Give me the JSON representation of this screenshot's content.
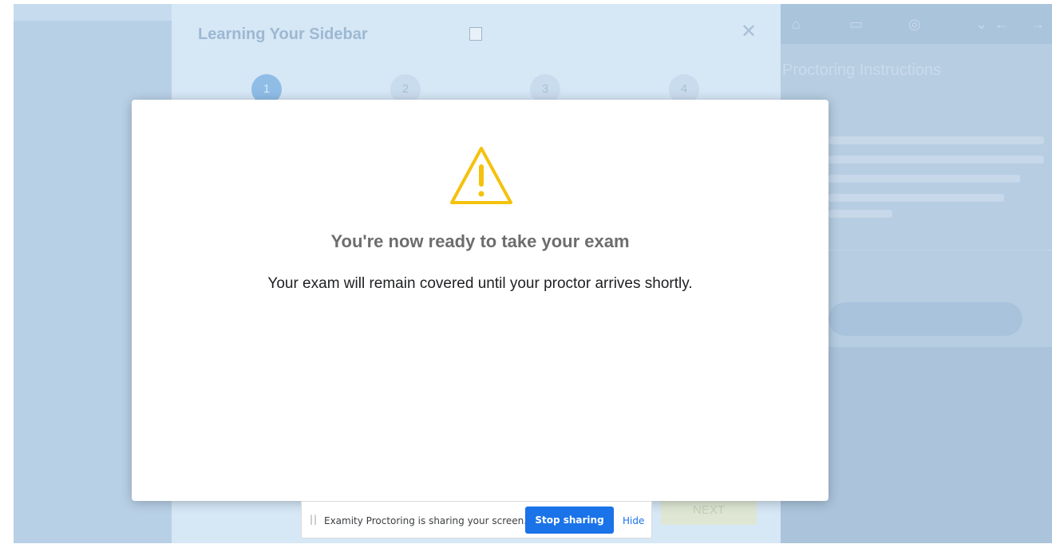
{
  "tour": {
    "title": "Learning Your Sidebar",
    "close_glyph": "✕",
    "steps": [
      "1",
      "2",
      "3",
      "4"
    ],
    "next_label": "NEXT"
  },
  "right_panel": {
    "title": "Proctoring Instructions",
    "icons": [
      "home-icon",
      "window-icon",
      "settings-icon",
      "chevron-down-icon",
      "arrow-left-icon",
      "arrow-right-icon"
    ]
  },
  "modal": {
    "heading": "You're now ready to take your exam",
    "body": "Your exam will remain covered until your proctor arrives shortly.",
    "icon": "warning-icon",
    "icon_color": "#f4c20d"
  },
  "share_bar": {
    "message": "Examity Proctoring is sharing your screen.",
    "stop_label": "Stop sharing",
    "hide_label": "Hide",
    "accent": "#1a73e8"
  }
}
